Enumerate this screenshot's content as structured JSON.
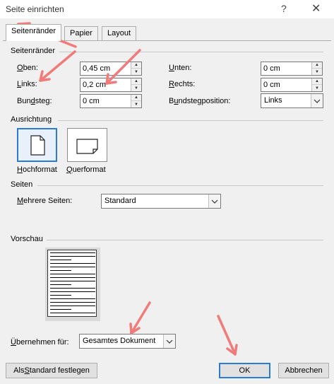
{
  "dialog": {
    "title": "Seite einrichten",
    "help_glyph": "?",
    "close_glyph": "✕"
  },
  "tabs": [
    {
      "label": "Seitenränder",
      "active": true
    },
    {
      "label": "Papier",
      "active": false
    },
    {
      "label": "Layout",
      "active": false
    }
  ],
  "margins": {
    "section_title": "Seitenränder",
    "top": {
      "label_ul": "O",
      "label_rest": "ben:",
      "value": "0,45 cm"
    },
    "left": {
      "label_ul": "L",
      "label_rest": "inks:",
      "value": "0,2 cm"
    },
    "gutter": {
      "label_pre": "Bun",
      "label_ul": "d",
      "label_rest": "steg:",
      "value": "0 cm"
    },
    "bottom": {
      "label_ul": "U",
      "label_rest": "nten:",
      "value": "0 cm"
    },
    "right": {
      "label_ul": "R",
      "label_rest": "echts:",
      "value": "0 cm"
    },
    "gutter_pos": {
      "label_pre": "B",
      "label_ul": "u",
      "label_rest": "ndstegposition:",
      "value": "Links"
    }
  },
  "orientation": {
    "section_title": "Ausrichtung",
    "portrait": {
      "label_ul": "H",
      "label_rest": "ochformat",
      "selected": true
    },
    "landscape": {
      "label_ul": "Q",
      "label_rest": "uerformat",
      "selected": false
    }
  },
  "pages": {
    "section_title": "Seiten",
    "multiple_label_ul": "M",
    "multiple_label_rest": "ehrere Seiten:",
    "multiple_value": "Standard"
  },
  "preview": {
    "section_title": "Vorschau"
  },
  "apply": {
    "label_ul": "Ü",
    "label_rest": "bernehmen für:",
    "value": "Gesamtes Dokument"
  },
  "buttons": {
    "set_default_pre": "Als ",
    "set_default_ul": "S",
    "set_default_rest": "tandard festlegen",
    "ok": "OK",
    "cancel": "Abbrechen"
  },
  "colors": {
    "annotation_arrow": "#f07b7b",
    "default_button_border": "#2b7bd3"
  }
}
